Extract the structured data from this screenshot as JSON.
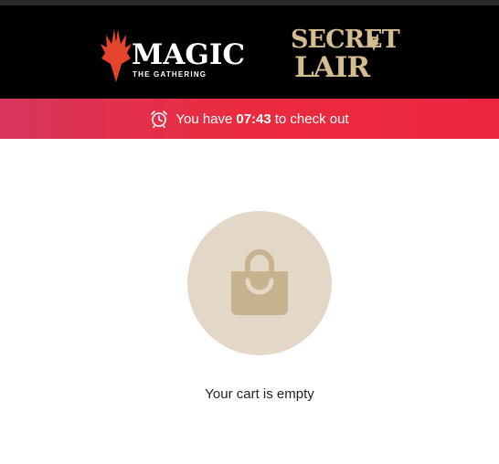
{
  "header": {
    "magic_logo": {
      "title": "MAGIC",
      "subtitle": "THE GATHERING"
    },
    "secret_lair_logo": {
      "line1": "SECRET",
      "line2": "LAIR",
      "color": "#d3bd91"
    }
  },
  "timer_bar": {
    "prefix": "You have",
    "time": "07:43",
    "suffix": "to check out",
    "icon": "alarm-clock-icon",
    "color": "#e9263e"
  },
  "cart": {
    "icon": "shopping-bag-icon",
    "icon_color": "#c7b290",
    "circle_color": "#e3d8c7",
    "empty_message": "Your cart is empty"
  }
}
